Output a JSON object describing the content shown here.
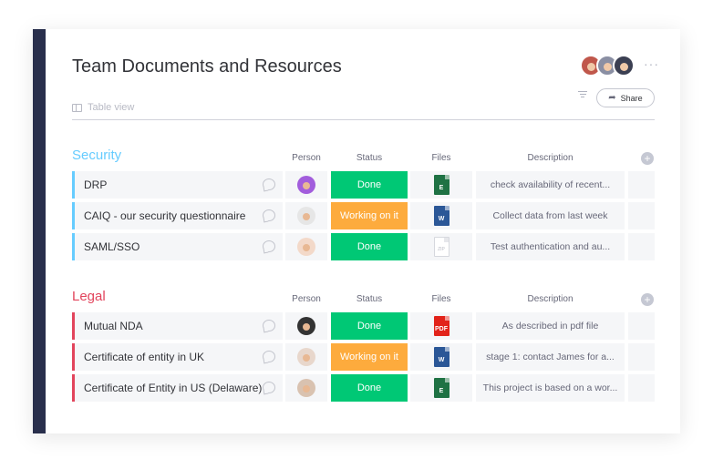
{
  "board": {
    "title": "Team Documents and Resources",
    "view_label": "Table view",
    "share_label": "Share",
    "more_label": "···"
  },
  "colors": {
    "done": "#00c875",
    "working": "#fdab3d",
    "security": "#579bfc",
    "legal": "#e2445c",
    "sidebar": "#292f4c"
  },
  "columns": {
    "person": "Person",
    "status": "Status",
    "files": "Files",
    "description": "Description"
  },
  "groups": [
    {
      "title": "Security",
      "color": "#66ccff",
      "rows": [
        {
          "name": "DRP",
          "status": "Done",
          "status_color": "#00c875",
          "file": {
            "label": "E",
            "kind": "excel",
            "color": "#1f7244"
          },
          "description": "check availability of recent...",
          "avatar_bg": "#a25ddc"
        },
        {
          "name": "CAIQ - our security questionnaire",
          "status": "Working on it",
          "status_color": "#fdab3d",
          "file": {
            "label": "W",
            "kind": "word",
            "color": "#2b5797"
          },
          "description": "Collect data from last week",
          "avatar_bg": "#e6e6e6"
        },
        {
          "name": "SAML/SSO",
          "status": "Done",
          "status_color": "#00c875",
          "file": {
            "label": "ZIP",
            "kind": "zip",
            "color": "#ffffff"
          },
          "description": "Test authentication and au...",
          "avatar_bg": "#f3d9c9"
        }
      ]
    },
    {
      "title": "Legal",
      "color": "#e2445c",
      "rows": [
        {
          "name": "Mutual NDA",
          "status": "Done",
          "status_color": "#00c875",
          "file": {
            "label": "PDF",
            "kind": "pdf",
            "color": "#e2231a"
          },
          "description": "As described in pdf file",
          "avatar_bg": "#333333"
        },
        {
          "name": "Certificate of entity in UK",
          "status": "Working on it",
          "status_color": "#fdab3d",
          "file": {
            "label": "W",
            "kind": "word",
            "color": "#2b5797"
          },
          "description": "stage 1: contact  James for a...",
          "avatar_bg": "#e8d7cc"
        },
        {
          "name": "Certificate of Entity in US (Delaware)",
          "status": "Done",
          "status_color": "#00c875",
          "file": {
            "label": "E",
            "kind": "excel",
            "color": "#1f7244"
          },
          "description": "This project is based on a wor...",
          "avatar_bg": "#d9c2b0"
        }
      ]
    }
  ]
}
